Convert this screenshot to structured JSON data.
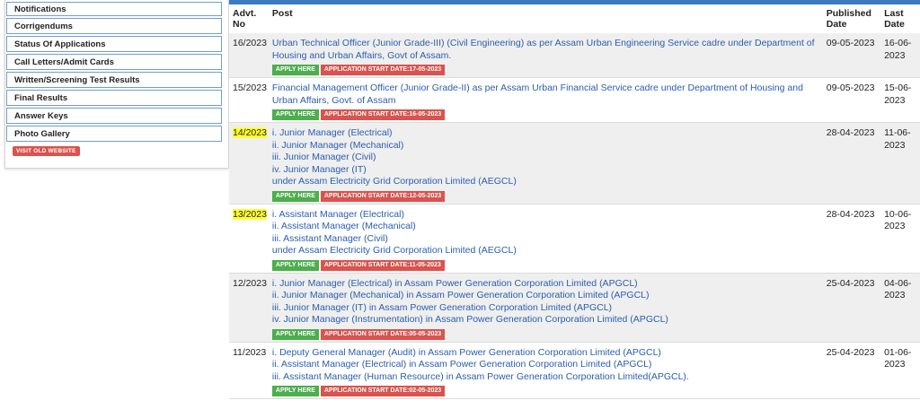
{
  "sidebar": {
    "items": [
      {
        "label": "Notifications"
      },
      {
        "label": "Corrigendums"
      },
      {
        "label": "Status Of Applications"
      },
      {
        "label": "Call Letters/Admit Cards"
      },
      {
        "label": "Written/Screening Test Results"
      },
      {
        "label": "Final Results"
      },
      {
        "label": "Answer Keys"
      },
      {
        "label": "Photo Gallery"
      }
    ],
    "old_website_label": "VISIT OLD WEBSITE"
  },
  "table": {
    "headers": {
      "advt_line1": "Advt.",
      "advt_line2": "No",
      "post": "Post",
      "published_line1": "Published",
      "published_line2": "Date",
      "last_line1": "Last",
      "last_line2": "Date"
    },
    "apply_label": "APPLY HERE",
    "rows": [
      {
        "advt": "16/2023",
        "lines": [
          "Urban Technical Officer (Junior Grade-III) (Civil Engineering) as per Assam Urban Engineering Service cadre under Department of Housing and Urban Affairs, Govt of Assam."
        ],
        "start": "APPLICATION START DATE:17-05-2023",
        "published": "09-05-2023",
        "last": "16-06-2023"
      },
      {
        "advt": "15/2023",
        "lines": [
          "Financial Management Officer (Junior Grade-II) as per Assam Urban Financial Service cadre under Department of Housing and Urban Affairs, Govt. of Assam"
        ],
        "start": "APPLICATION START DATE:16-05-2023",
        "published": "09-05-2023",
        "last": "15-06-2023"
      },
      {
        "advt": "14/2023",
        "lines": [
          "i. Junior Manager (Electrical)",
          "ii. Junior Manager (Mechanical)",
          "iii. Junior Manager (Civil)",
          "iv. Junior Manager (IT)",
          "under Assam Electricity Grid Corporation Limited (AEGCL)"
        ],
        "start": "APPLICATION START DATE:12-05-2023",
        "published": "28-04-2023",
        "last": "11-06-2023"
      },
      {
        "advt": "13/2023",
        "lines": [
          "i. Assistant Manager (Electrical)",
          "ii. Assistant Manager (Mechanical)",
          "iii. Assistant Manager (Civil)",
          "under Assam Electricity Grid Corporation Limited (AEGCL)"
        ],
        "start": "APPLICATION START DATE:11-05-2023",
        "published": "28-04-2023",
        "last": "10-06-2023"
      },
      {
        "advt": "12/2023",
        "lines": [
          "i. Junior Manager (Electrical) in Assam Power Generation Corporation Limited (APGCL)",
          "ii. Junior Manager (Mechanical) in Assam Power Generation Corporation Limited (APGCL)",
          "iii. Junior Manager (IT) in Assam Power Generation Corporation Limited (APGCL)",
          "iv. Junior Manager (Instrumentation) in Assam Power Generation Corporation Limited (APGCL)"
        ],
        "start": "APPLICATION START DATE:05-05-2023",
        "published": "25-04-2023",
        "last": "04-06-2023"
      },
      {
        "advt": "11/2023",
        "lines": [
          "i. Deputy General Manager (Audit) in Assam Power Generation Corporation Limited (APGCL)",
          "ii. Assistant Manager (Electrical) in Assam Power Generation Corporation Limited (APGCL)",
          "iii. Assistant Manager (Human Resource) in Assam Power Generation Corporation Limited(APGCL)."
        ],
        "start": "APPLICATION START DATE:02-05-2023",
        "published": "25-04-2023",
        "last": "01-06-2023"
      }
    ]
  }
}
